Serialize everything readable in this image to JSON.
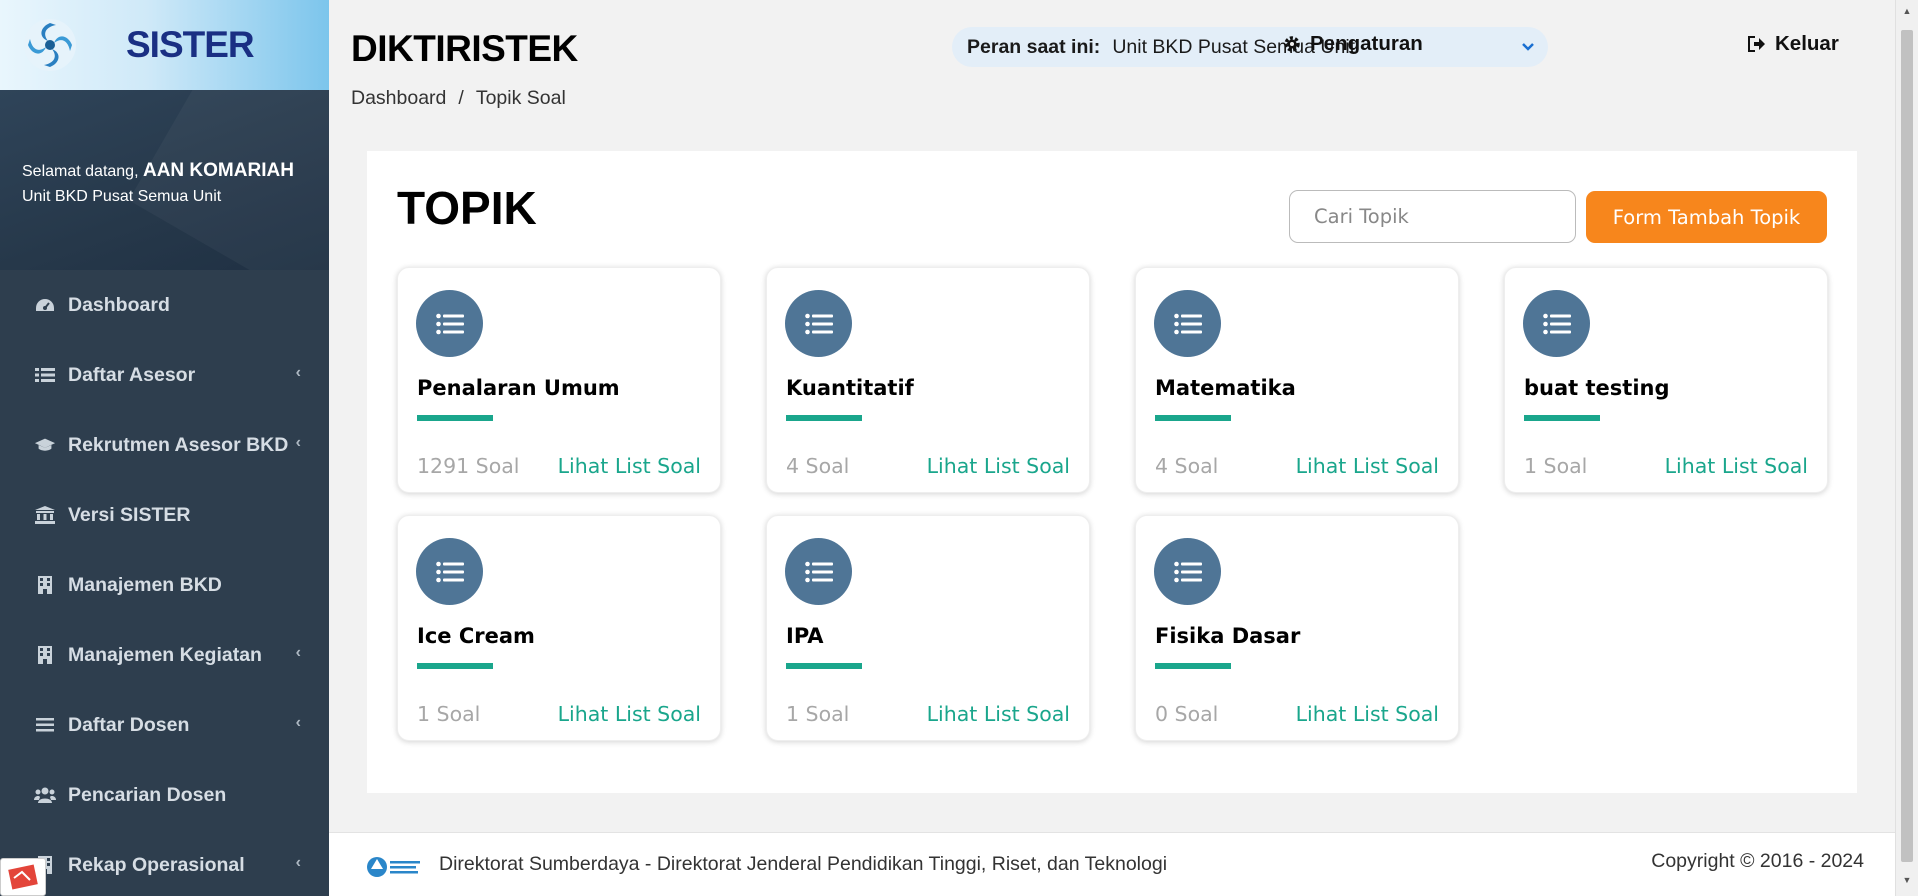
{
  "brand": {
    "name": "SISTER"
  },
  "welcome": {
    "prefix": "Selamat datang,",
    "user": "AAN KOMARIAH",
    "unit": "Unit BKD Pusat Semua Unit"
  },
  "sidebar": {
    "items": [
      {
        "label": "Dashboard",
        "icon": "dashboard-icon",
        "has_submenu": false
      },
      {
        "label": "Daftar Asesor",
        "icon": "list-icon",
        "has_submenu": true
      },
      {
        "label": "Rekrutmen Asesor BKD",
        "icon": "graduation-cap-icon",
        "has_submenu": true
      },
      {
        "label": "Versi SISTER",
        "icon": "institution-icon",
        "has_submenu": false
      },
      {
        "label": "Manajemen BKD",
        "icon": "building-icon",
        "has_submenu": false
      },
      {
        "label": "Manajemen Kegiatan",
        "icon": "building-icon",
        "has_submenu": true
      },
      {
        "label": "Daftar Dosen",
        "icon": "bars-icon",
        "has_submenu": true
      },
      {
        "label": "Pencarian Dosen",
        "icon": "users-icon",
        "has_submenu": false
      },
      {
        "label": "Rekap Operasional",
        "icon": "building-icon",
        "has_submenu": true
      }
    ]
  },
  "header": {
    "title": "DIKTIRISTEK",
    "breadcrumb": [
      "Dashboard",
      "/",
      "Topik Soal"
    ],
    "role_label": "Peran saat ini:",
    "role_value": "Unit BKD Pusat Semua Unit",
    "settings_label": "Pengaturan",
    "logout_label": "Keluar"
  },
  "main": {
    "title": "TOPIK",
    "search_placeholder": "Cari Topik",
    "add_button": "Form Tambah Topik",
    "link_label": "Lihat List Soal",
    "topics": [
      {
        "name": "Penalaran Umum",
        "count": "1291 Soal"
      },
      {
        "name": "Kuantitatif",
        "count": "4 Soal"
      },
      {
        "name": "Matematika",
        "count": "4 Soal"
      },
      {
        "name": "buat testing",
        "count": "1 Soal"
      },
      {
        "name": "Ice Cream",
        "count": "1 Soal"
      },
      {
        "name": "IPA",
        "count": "1 Soal"
      },
      {
        "name": "Fisika Dasar",
        "count": "0 Soal"
      }
    ]
  },
  "footer": {
    "text": "Direktorat Sumberdaya - Direktorat Jenderal Pendidikan Tinggi, Riset, dan Teknologi",
    "copyright": "Copyright © 2016 - 2024"
  },
  "colors": {
    "accent": "#f7861c",
    "teal": "#1aa68c",
    "sidebar": "#2e3e4e",
    "icon_circle": "#4f7596"
  }
}
